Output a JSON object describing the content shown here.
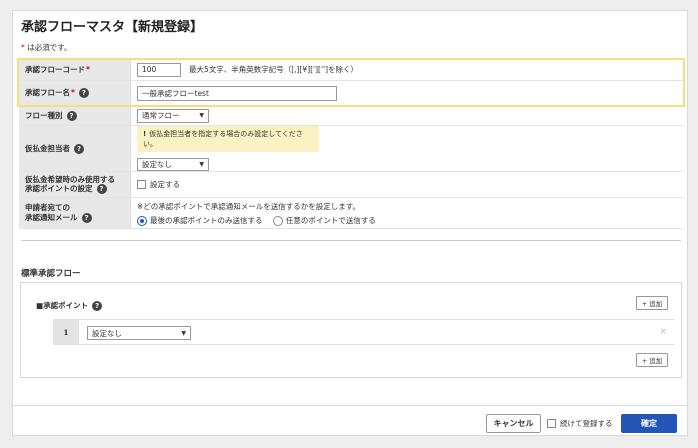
{
  "page": {
    "title": "承認フローマスタ【新規登録】",
    "required_note_star": "*",
    "required_note": " は必須です。"
  },
  "form": {
    "code": {
      "label": "承認フローコード",
      "value": "100",
      "hint": "最大5文字、半角英数字記号（[,][¥][']['']を除く）"
    },
    "name": {
      "label": "承認フロー名",
      "value": "一般承認フローtest"
    },
    "type": {
      "label": "フロー種別",
      "selected": "通常フロー"
    },
    "advance": {
      "label": "仮払金担当者",
      "warning": "仮払金担当者を指定する場合のみ設定してください。",
      "selected": "設定なし"
    },
    "point_setting": {
      "label_line1": "仮払金希望時のみ使用する",
      "label_line2": "承認ポイントの設定",
      "checkbox_label": "設定する"
    },
    "notify": {
      "label_line1": "申請者宛ての",
      "label_line2": "承認通知メール",
      "description": "※どの承認ポイントで承認通知メールを送信するかを設定します。",
      "option_last": "最後の承認ポイントのみ送信する",
      "option_any": "任意のポイントで送信する"
    }
  },
  "flow": {
    "section_title": "標準承認フロー",
    "point_title": "■承認ポイント",
    "add_label": "+ 追加",
    "points": [
      {
        "number": "1",
        "selected": "設定なし"
      }
    ]
  },
  "footer": {
    "cancel": "キャンセル",
    "continue_label": "続けて登録する",
    "confirm": "確定"
  }
}
